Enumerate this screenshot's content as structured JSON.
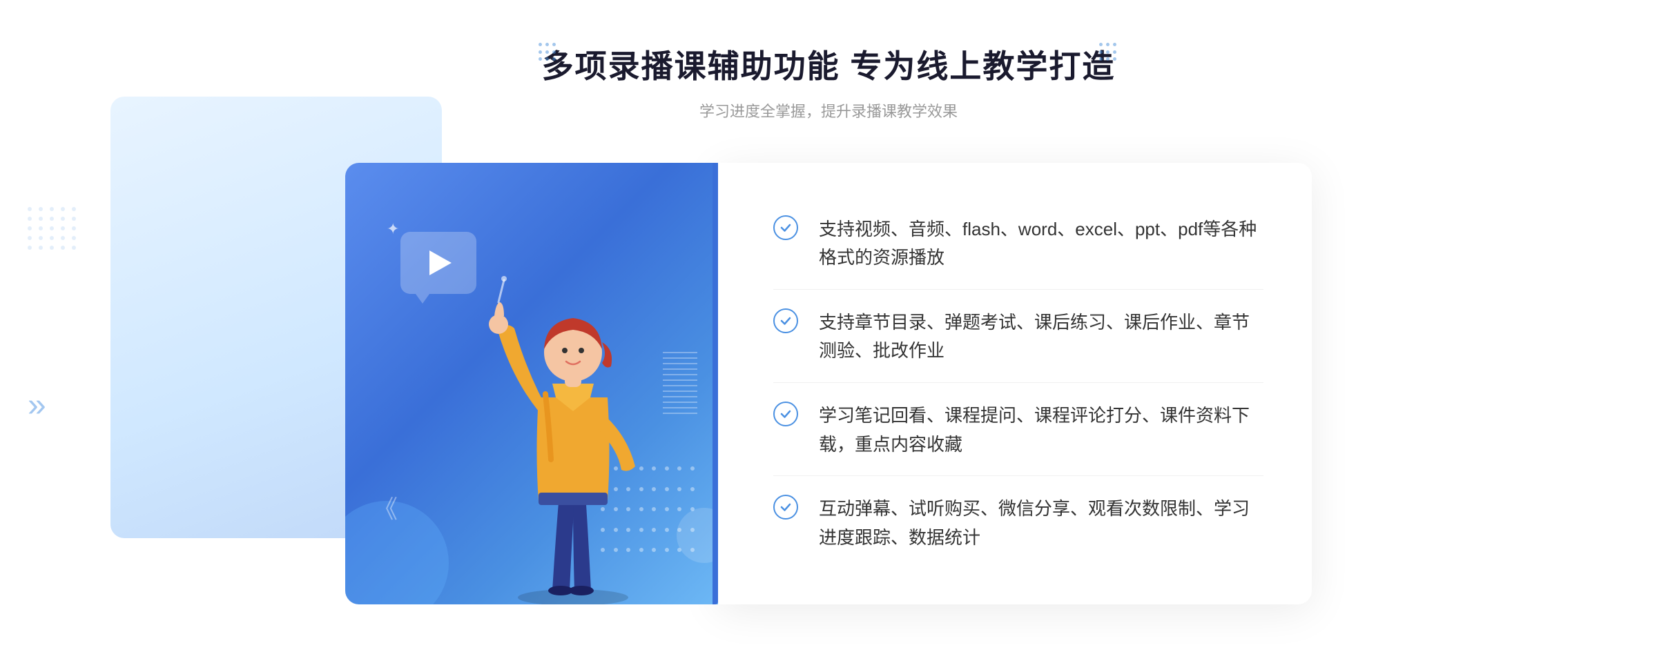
{
  "header": {
    "title": "多项录播课辅助功能 专为线上教学打造",
    "subtitle": "学习进度全掌握，提升录播课教学效果"
  },
  "features": [
    {
      "id": "feature-1",
      "text": "支持视频、音频、flash、word、excel、ppt、pdf等各种格式的资源播放"
    },
    {
      "id": "feature-2",
      "text": "支持章节目录、弹题考试、课后练习、课后作业、章节测验、批改作业"
    },
    {
      "id": "feature-3",
      "text": "学习笔记回看、课程提问、课程评论打分、课件资料下载，重点内容收藏"
    },
    {
      "id": "feature-4",
      "text": "互动弹幕、试听购买、微信分享、观看次数限制、学习进度跟踪、数据统计"
    }
  ],
  "decorations": {
    "left_chevron": "»",
    "check_color": "#4a90e2"
  }
}
